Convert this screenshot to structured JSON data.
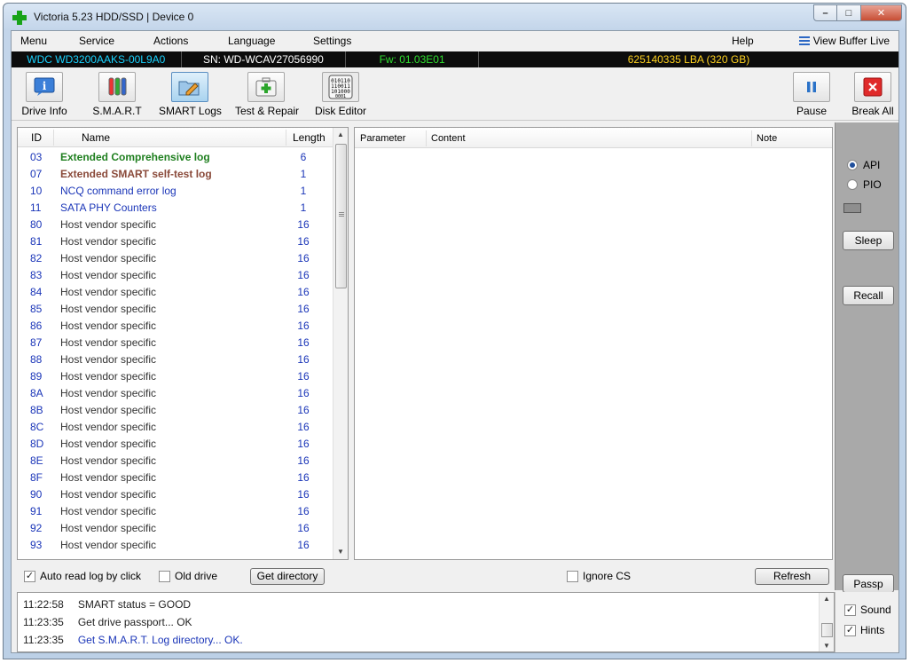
{
  "window": {
    "title": "Victoria 5.23 HDD/SSD | Device 0"
  },
  "menu": {
    "items": [
      "Menu",
      "Service",
      "Actions",
      "Language",
      "Settings"
    ],
    "help": "Help",
    "view_buffer": "View Buffer Live"
  },
  "drive": {
    "model": "WDC WD3200AAKS-00L9A0",
    "serial": "SN: WD-WCAV27056990",
    "firmware": "Fw: 01.03E01",
    "capacity": "625140335 LBA (320 GB)"
  },
  "toolbar": {
    "drive_info": "Drive Info",
    "smart": "S.M.A.R.T",
    "smart_logs": "SMART Logs",
    "test_repair": "Test & Repair",
    "disk_editor": "Disk Editor",
    "pause": "Pause",
    "break_all": "Break All"
  },
  "loglist": {
    "columns": {
      "id": "ID",
      "name": "Name",
      "length": "Length"
    },
    "rows": [
      {
        "id": "03",
        "name": "Extended Comprehensive log",
        "length": "6"
      },
      {
        "id": "07",
        "name": "Extended SMART self-test log",
        "length": "1"
      },
      {
        "id": "10",
        "name": "NCQ command error log",
        "length": "1"
      },
      {
        "id": "11",
        "name": "SATA PHY Counters",
        "length": "1"
      },
      {
        "id": "80",
        "name": "Host vendor specific",
        "length": "16"
      },
      {
        "id": "81",
        "name": "Host vendor specific",
        "length": "16"
      },
      {
        "id": "82",
        "name": "Host vendor specific",
        "length": "16"
      },
      {
        "id": "83",
        "name": "Host vendor specific",
        "length": "16"
      },
      {
        "id": "84",
        "name": "Host vendor specific",
        "length": "16"
      },
      {
        "id": "85",
        "name": "Host vendor specific",
        "length": "16"
      },
      {
        "id": "86",
        "name": "Host vendor specific",
        "length": "16"
      },
      {
        "id": "87",
        "name": "Host vendor specific",
        "length": "16"
      },
      {
        "id": "88",
        "name": "Host vendor specific",
        "length": "16"
      },
      {
        "id": "89",
        "name": "Host vendor specific",
        "length": "16"
      },
      {
        "id": "8A",
        "name": "Host vendor specific",
        "length": "16"
      },
      {
        "id": "8B",
        "name": "Host vendor specific",
        "length": "16"
      },
      {
        "id": "8C",
        "name": "Host vendor specific",
        "length": "16"
      },
      {
        "id": "8D",
        "name": "Host vendor specific",
        "length": "16"
      },
      {
        "id": "8E",
        "name": "Host vendor specific",
        "length": "16"
      },
      {
        "id": "8F",
        "name": "Host vendor specific",
        "length": "16"
      },
      {
        "id": "90",
        "name": "Host vendor specific",
        "length": "16"
      },
      {
        "id": "91",
        "name": "Host vendor specific",
        "length": "16"
      },
      {
        "id": "92",
        "name": "Host vendor specific",
        "length": "16"
      },
      {
        "id": "93",
        "name": "Host vendor specific",
        "length": "16"
      }
    ]
  },
  "detail": {
    "columns": {
      "parameter": "Parameter",
      "content": "Content",
      "note": "Note"
    }
  },
  "bottom": {
    "auto_read": "Auto read log by click",
    "old_drive": "Old drive",
    "get_directory": "Get directory",
    "ignore_cs": "Ignore CS",
    "refresh": "Refresh"
  },
  "side": {
    "api": "API",
    "pio": "PIO",
    "sleep": "Sleep",
    "recall": "Recall",
    "passp": "Passp",
    "sound": "Sound",
    "hints": "Hints"
  },
  "console": {
    "lines": [
      {
        "time": "11:22:58",
        "msg": "SMART status = GOOD"
      },
      {
        "time": "11:23:35",
        "msg": "Get drive passport... OK"
      },
      {
        "time": "11:23:35",
        "msg": "Get S.M.A.R.T. Log directory... OK."
      }
    ]
  },
  "colors": {
    "model_text": "#19d3ff",
    "serial_text": "#ffffff",
    "firmware_text": "#2fe02f",
    "capacity_text": "#ffd21f"
  }
}
